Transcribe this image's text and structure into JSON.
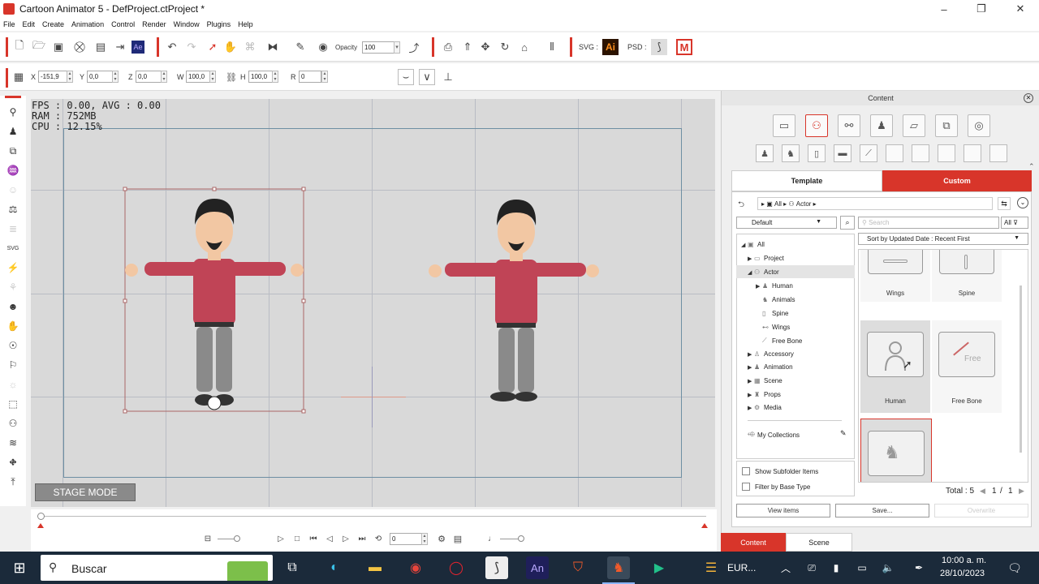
{
  "window": {
    "title": "Cartoon Animator 5 - DefProject.ctProject *",
    "minimize_icon": "–",
    "maximize_icon": "❐",
    "close_icon": "✕"
  },
  "menu": [
    "File",
    "Edit",
    "Create",
    "Animation",
    "Control",
    "Render",
    "Window",
    "Plugins",
    "Help"
  ],
  "toolbar": {
    "opacity_label": "Opacity",
    "opacity_value": "100",
    "svg_label": "SVG :",
    "ai_label": "Ai",
    "psd_label": "PSD :",
    "ae_label": "Ae"
  },
  "transform": {
    "x_label": "X",
    "x_value": "-151,9",
    "y_label": "Y",
    "y_value": "0,0",
    "z_label": "Z",
    "z_value": "0,0",
    "w_label": "W",
    "w_value": "100,0",
    "h_label": "H",
    "h_value": "100,0",
    "r_label": "R",
    "r_value": "0"
  },
  "stage": {
    "stats": "FPS : 0.00, AVG : 0.00\nRAM : 752MB\nCPU : 12.15%",
    "mode_button": "STAGE MODE"
  },
  "timeline": {
    "frame_value": "0"
  },
  "content": {
    "title": "Content",
    "tabs": {
      "template": "Template",
      "custom": "Custom"
    },
    "breadcrumb": {
      "all": "All",
      "actor": "Actor"
    },
    "filter_default": "Default",
    "search_placeholder": "Search",
    "search_scope": "All",
    "sort": "Sort by Updated Date : Recent First",
    "tree": [
      {
        "label": "All",
        "arrow": "◢",
        "icon": "▣",
        "indent": 0
      },
      {
        "label": "Project",
        "arrow": "▶",
        "icon": "▭",
        "indent": 1
      },
      {
        "label": "Actor",
        "arrow": "◢",
        "icon": "⚇",
        "indent": 1
      },
      {
        "label": "Human",
        "arrow": "▶",
        "icon": "♟",
        "indent": 2
      },
      {
        "label": "Animals",
        "arrow": "",
        "icon": "♞",
        "indent": 2
      },
      {
        "label": "Spine",
        "arrow": "",
        "icon": "▯",
        "indent": 2
      },
      {
        "label": "Wings",
        "arrow": "",
        "icon": "⊷",
        "indent": 2
      },
      {
        "label": "Free Bone",
        "arrow": "",
        "icon": "⟋",
        "indent": 2
      },
      {
        "label": "Accessory",
        "arrow": "▶",
        "icon": "♙",
        "indent": 1
      },
      {
        "label": "Animation",
        "arrow": "▶",
        "icon": "♟",
        "indent": 1
      },
      {
        "label": "Scene",
        "arrow": "▶",
        "icon": "▦",
        "indent": 1
      },
      {
        "label": "Props",
        "arrow": "▶",
        "icon": "♜",
        "indent": 1
      },
      {
        "label": "Media",
        "arrow": "▶",
        "icon": "⚙",
        "indent": 1
      }
    ],
    "my_collections": "My Collections",
    "items": [
      {
        "label": "Wings"
      },
      {
        "label": "Spine"
      },
      {
        "label": "Human"
      },
      {
        "label": "Free Bone"
      },
      {
        "label": ""
      }
    ],
    "free_text": "Free",
    "show_subfolder": "Show Subfolder Items",
    "filter_base": "Filter by Base Type",
    "total": "Total : 5",
    "page_current": "1",
    "page_sep": "/",
    "page_total": "1",
    "view_items": "View items",
    "save": "Save...",
    "overwrite": "Overwrite",
    "bottom_tabs": {
      "content": "Content",
      "scene": "Scene"
    }
  },
  "taskbar": {
    "search_placeholder": "Buscar",
    "app_ae": "An",
    "eur_label": "EUR...",
    "time": "10:00 a. m.",
    "date": "28/10/2023"
  },
  "colors": {
    "accent": "#d8352a",
    "stage": "#d9d9d9",
    "shirt": "#c04456",
    "pants": "#8a8a8a",
    "taskbar": "#1b2a3a"
  }
}
